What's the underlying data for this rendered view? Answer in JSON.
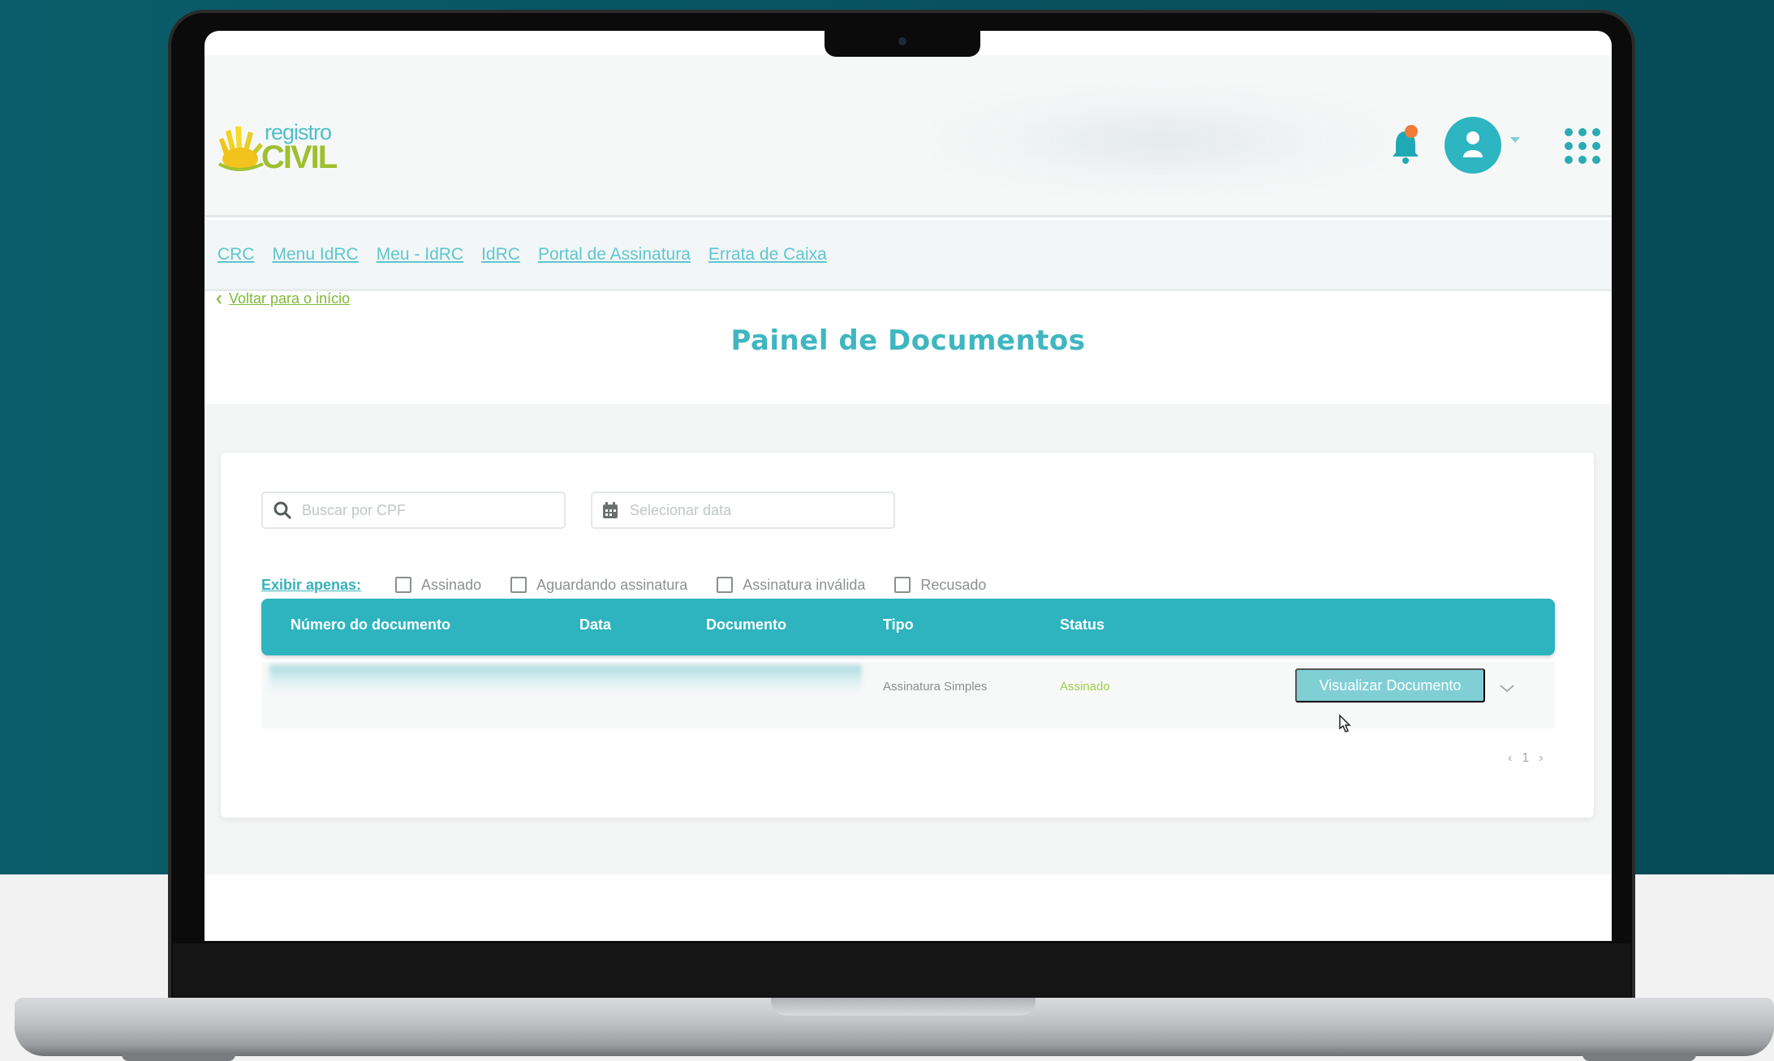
{
  "logo": {
    "top_text": "registro",
    "bottom_text": "CIVIL"
  },
  "header": {
    "notification_icon": "bell-icon",
    "avatar_icon": "user-icon",
    "apps_icon": "grid-dots-icon"
  },
  "nav": {
    "links": [
      "CRC",
      "Menu IdRC",
      "Meu - IdRC",
      "IdRC",
      "Portal de Assinatura",
      "Errata de Caixa"
    ]
  },
  "back": {
    "label": "Voltar para o início"
  },
  "page": {
    "title": "Painel de Documentos"
  },
  "search": {
    "placeholder": "Buscar por CPF"
  },
  "date": {
    "placeholder": "Selecionar data"
  },
  "filters": {
    "label": "Exibir apenas:",
    "options": [
      "Assinado",
      "Aguardando assinatura",
      "Assinatura inválida",
      "Recusado"
    ]
  },
  "table": {
    "headers": [
      "Número do documento",
      "Data",
      "Documento",
      "Tipo",
      "Status"
    ],
    "rows": [
      {
        "tipo": "Assinatura Simples",
        "status": "Assinado",
        "action": "Visualizar Documento"
      }
    ]
  },
  "pagination": {
    "prev": "‹",
    "page": "1",
    "next": "›"
  },
  "colors": {
    "primary": "#2db4bf",
    "title": "#3fb6c0",
    "accent_green": "#7fb93a",
    "notification": "#f07b38",
    "status_signed": "#9fd04a",
    "backdrop_teal": "#07525e"
  }
}
